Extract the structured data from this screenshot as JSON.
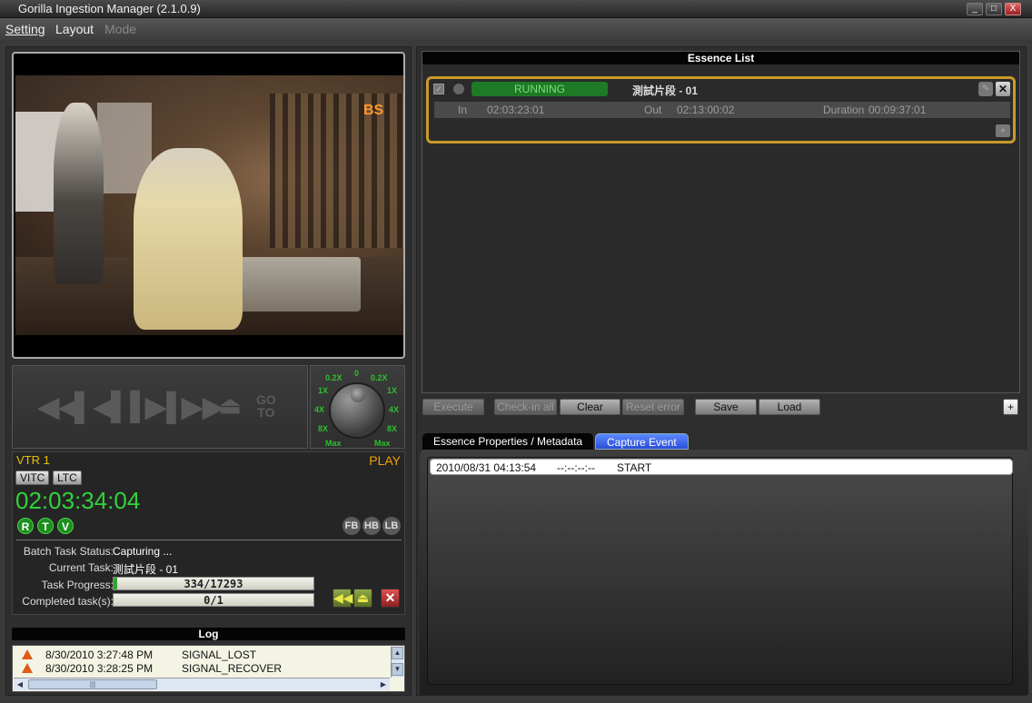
{
  "window": {
    "title": "Gorilla Ingestion Manager (2.1.0.9)",
    "minimize": "_",
    "maximize": "□",
    "close": "X"
  },
  "menu": {
    "setting": "Setting",
    "layout": "Layout",
    "mode": "Mode"
  },
  "video": {
    "logo": "BS"
  },
  "transport": {
    "goto": "GO\nTO"
  },
  "jog": {
    "left_labels": [
      "0.2X",
      "1X",
      "4X",
      "8X",
      "Max"
    ],
    "right_labels": [
      "0.2X",
      "1X",
      "4X",
      "8X",
      "Max"
    ],
    "center": "0"
  },
  "vtr": {
    "name": "VTR 1",
    "state": "PLAY",
    "vitc": "VITC",
    "ltc": "LTC",
    "timecode": "02:03:34:04",
    "flags": [
      "R",
      "T",
      "V"
    ],
    "modes": [
      "FB",
      "HB",
      "LB"
    ],
    "batch_status_label": "Batch Task Status:",
    "batch_status_value": "Capturing ...",
    "current_task_label": "Current Task:",
    "current_task_value": "測試片段 - 01",
    "progress_label": "Task Progress:",
    "progress_text": "334/17293",
    "progress_fraction": 0.019,
    "completed_label": "Completed task(s):",
    "completed_text": "0/1",
    "completed_fraction": 0
  },
  "log": {
    "title": "Log",
    "rows": [
      {
        "time": "8/30/2010 3:27:48 PM",
        "event": "SIGNAL_LOST"
      },
      {
        "time": "8/30/2010 3:28:25 PM",
        "event": "SIGNAL_RECOVER"
      }
    ],
    "scroll_grip": "|||"
  },
  "essence": {
    "title": "Essence List",
    "status": "RUNNING",
    "name": "測試片段 - 01",
    "in_label": "In",
    "in_value": "02:03:23:01",
    "out_label": "Out",
    "out_value": "02:13:00:02",
    "duration_label": "Duration",
    "duration_value": "00:09:37:01",
    "add": "+",
    "buttons": {
      "execute": "Execute",
      "checkin_all": "Check-in all",
      "clear": "Clear",
      "reset_error": "Reset error",
      "save": "Save",
      "load": "Load",
      "plus": "+"
    }
  },
  "tabs": {
    "properties": "Essence Properties / Metadata",
    "capture": "Capture Event",
    "events": [
      {
        "time": "2010/08/31 04:13:54",
        "tc": "--:--:--:--",
        "event": "START"
      }
    ]
  }
}
